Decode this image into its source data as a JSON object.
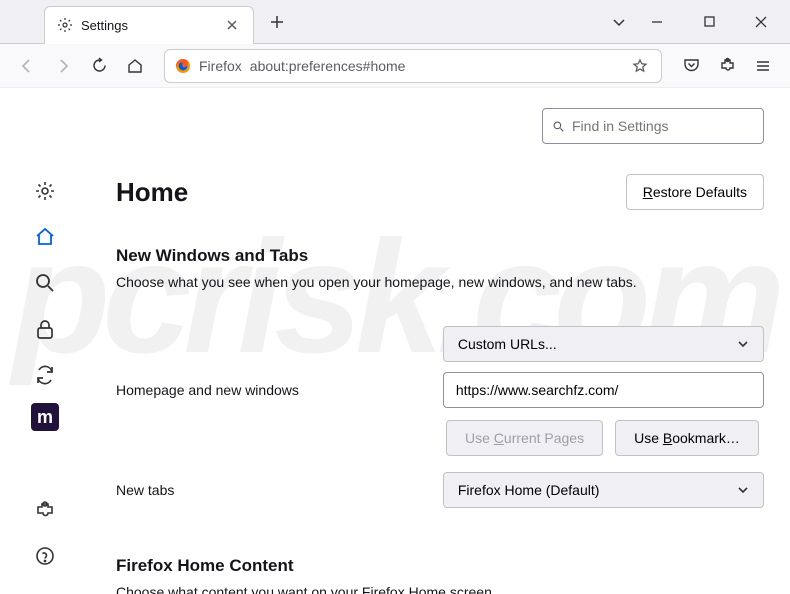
{
  "window": {
    "tab_title": "Settings"
  },
  "toolbar": {
    "identity": "Firefox",
    "url": "about:preferences#home"
  },
  "search": {
    "placeholder": "Find in Settings"
  },
  "page": {
    "title": "Home",
    "restore_label": "Restore Defaults"
  },
  "section1": {
    "title": "New Windows and Tabs",
    "desc": "Choose what you see when you open your homepage, new windows, and new tabs.",
    "homepage_label": "Homepage and new windows",
    "homepage_dropdown": "Custom URLs...",
    "homepage_url": "https://www.searchfz.com/",
    "use_current": "Use Current Pages",
    "use_bookmark": "Use Bookmark…",
    "newtabs_label": "New tabs",
    "newtabs_dropdown": "Firefox Home (Default)"
  },
  "section2": {
    "title": "Firefox Home Content",
    "desc": "Choose what content you want on your Firefox Home screen."
  }
}
